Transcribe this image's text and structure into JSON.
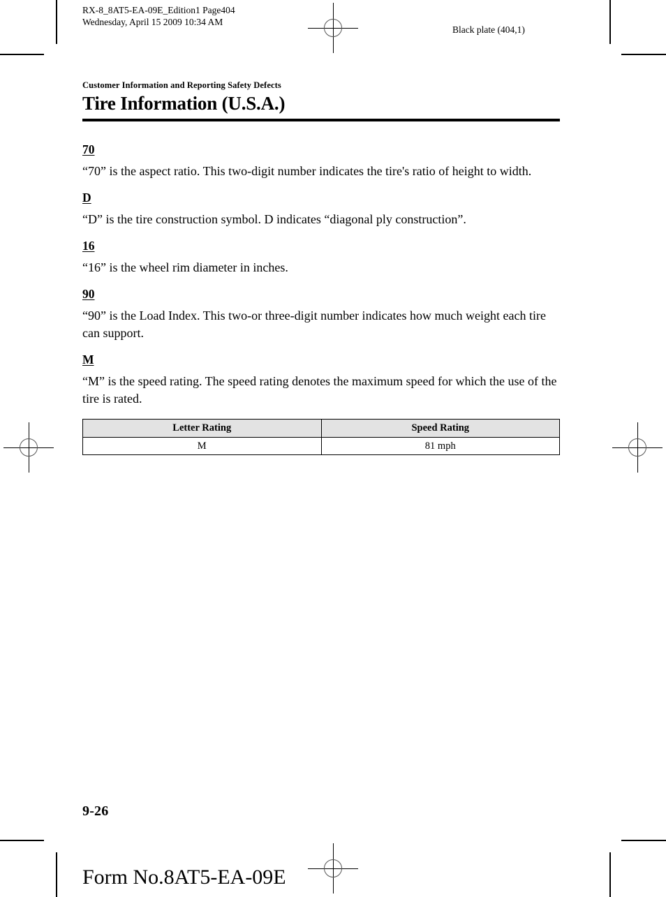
{
  "print_header": {
    "file_line": "RX-8_8AT5-EA-09E_Edition1 Page404",
    "date_line": "Wednesday, April 15 2009 10:34 AM",
    "plate_info": "Black plate (404,1)"
  },
  "chapter": {
    "section_label": "Customer Information and Reporting Safety Defects",
    "title": "Tire Information (U.S.A.)"
  },
  "entries": [
    {
      "term": "70",
      "text": "“70” is the aspect ratio. This two-digit number indicates the tire's ratio of height to width."
    },
    {
      "term": "D",
      "text": "“D” is the tire construction symbol. D indicates “diagonal ply construction”."
    },
    {
      "term": "16",
      "text": "“16” is the wheel rim diameter in inches."
    },
    {
      "term": "90",
      "text": "“90” is the Load Index. This two-or three-digit number indicates how much weight each tire can support."
    },
    {
      "term": "M",
      "text": "“M” is the speed rating. The speed rating denotes the maximum speed for which the use of the tire is rated."
    }
  ],
  "speed_table": {
    "headers": [
      "Letter Rating",
      "Speed Rating"
    ],
    "rows": [
      [
        "M",
        "81 mph"
      ]
    ]
  },
  "footer": {
    "page_number": "9-26",
    "form_number": "Form No.8AT5-EA-09E"
  }
}
